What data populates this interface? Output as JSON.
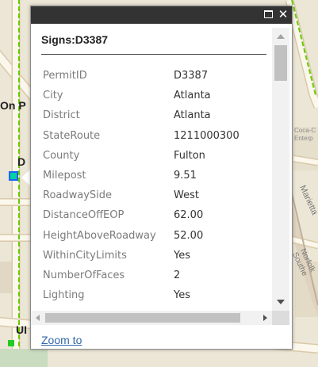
{
  "map": {
    "labels": [
      "On P",
      "D",
      "UI",
      "Coca-C",
      "Enterp",
      "Marietta",
      "Norfolk Southe"
    ],
    "colors": {
      "land": "#ece6d6",
      "road": "#fbf7ec",
      "street_casing": "#d9c9a8",
      "park": "#c9dcc0",
      "rail": "#d2c4b0",
      "highlight": "#66cc00"
    }
  },
  "popup": {
    "title": "Signs:D3387",
    "zoom_label": "Zoom to",
    "icons": {
      "maximize": "maximize-icon",
      "close": "close-icon"
    },
    "attributes": [
      {
        "name": "PermitID",
        "value": "D3387"
      },
      {
        "name": "City",
        "value": "Atlanta"
      },
      {
        "name": "District",
        "value": "Atlanta"
      },
      {
        "name": "StateRoute",
        "value": "1211000300"
      },
      {
        "name": "County",
        "value": "Fulton"
      },
      {
        "name": "Milepost",
        "value": "9.51"
      },
      {
        "name": "RoadwaySide",
        "value": "West"
      },
      {
        "name": "DistanceOffEOP",
        "value": "62.00"
      },
      {
        "name": "HeightAboveRoadway",
        "value": "52.00"
      },
      {
        "name": "WithinCityLimits",
        "value": "Yes"
      },
      {
        "name": "NumberOfFaces",
        "value": "2"
      },
      {
        "name": "Lighting",
        "value": "Yes"
      }
    ]
  }
}
